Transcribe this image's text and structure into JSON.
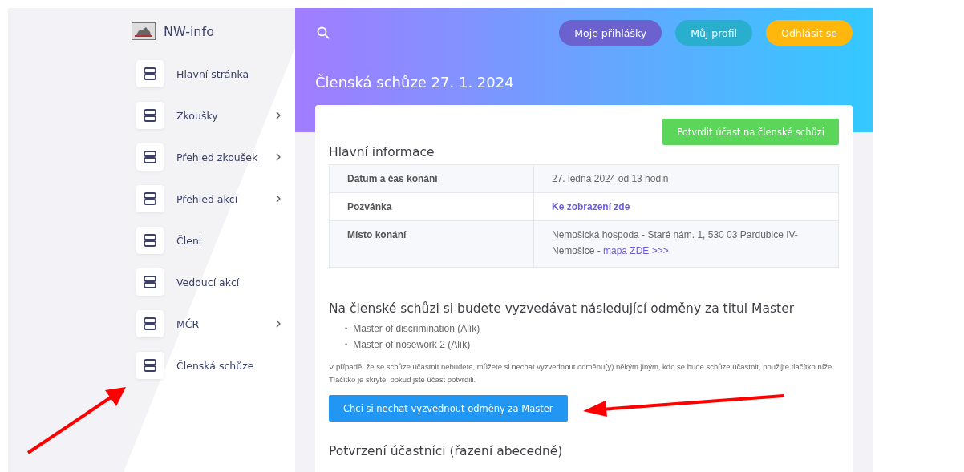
{
  "brand": {
    "title": "NW-info"
  },
  "sidebar": {
    "items": [
      {
        "label": "Hlavní stránka",
        "has_submenu": false
      },
      {
        "label": "Zkoušky",
        "has_submenu": true
      },
      {
        "label": "Přehled zkoušek",
        "has_submenu": true
      },
      {
        "label": "Přehled akcí",
        "has_submenu": true
      },
      {
        "label": "Členi",
        "has_submenu": false
      },
      {
        "label": "Vedoucí akcí",
        "has_submenu": false
      },
      {
        "label": "MČR",
        "has_submenu": true
      },
      {
        "label": "Členská schůze",
        "has_submenu": false
      }
    ]
  },
  "topbar": {
    "buttons": [
      {
        "label": "Moje přihlášky",
        "kind": "primary"
      },
      {
        "label": "Můj profil",
        "kind": "info"
      },
      {
        "label": "Odhlásit se",
        "kind": "warning"
      }
    ]
  },
  "page_title": "Členská schůze 27. 1. 2024",
  "confirm_button": "Potvrdit účast na členské schůzi",
  "info": {
    "title": "Hlavní informace",
    "rows": [
      {
        "label": "Datum a čas konání",
        "value": "27. ledna 2024 od 13 hodin",
        "kind": "text"
      },
      {
        "label": "Pozvánka",
        "value": "Ke zobrazení zde",
        "kind": "link"
      },
      {
        "label": "Místo konání",
        "value": "Nemošická hospoda - Staré nám. 1, 530 03 Pardubice IV-Nemošice - ",
        "link": "mapa ZDE >>>",
        "kind": "text_link"
      }
    ]
  },
  "rewards": {
    "title": "Na členské schůzi si budete vyzvedávat následující odměny za titul Master",
    "marker": "•",
    "items": [
      "Master of discrimination (Alík)",
      "Master of nosework 2 (Alík)"
    ],
    "note": "V případě, že se schůze účastnit nebudete, můžete si nechat vyzvednout odměnu(y) někým jiným, kdo se bude schůze účastnit, použijte tlačítko níže. Tlačítko je skryté, pokud jste účast potvrdili.",
    "button": "Chci si nechat vyzvednout odměny za Master"
  },
  "participants": {
    "title": "Potvrzení účastníci (řazení abecedně)"
  }
}
